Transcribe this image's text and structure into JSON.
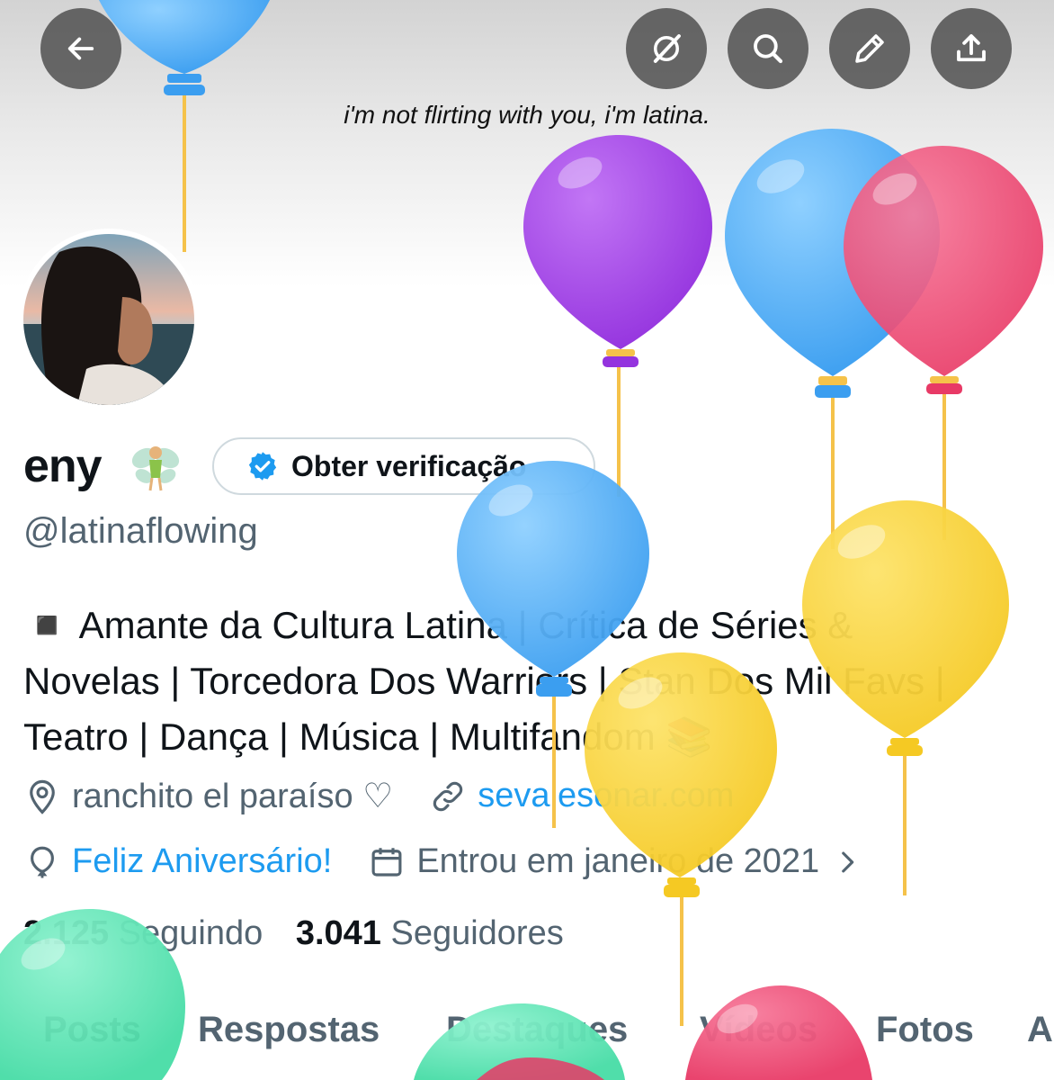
{
  "banner": {
    "caption": "i'm not flirting with you, i'm latina."
  },
  "toolbar": {
    "back_icon": "arrow-left-icon",
    "grok_icon": "grok-icon",
    "search_icon": "search-icon",
    "edit_icon": "pencil-icon",
    "share_icon": "share-icon"
  },
  "profile": {
    "display_name": "eny",
    "emoji": "fairy",
    "verify_button_label": "Obter verificação",
    "handle": "@latinaflowing",
    "bio_lines": [
      "◾ Amante da Cultura Latina | Crítica de Séries &",
      "Novelas | Torcedora Dos Warriors | Stan Dos Mil Favs |",
      "Teatro | Dança | Música | Multifandom 📚"
    ],
    "location": "ranchito el paraíso ♡",
    "website": "sevalesonar.com",
    "birthday": "Feliz Aniversário!",
    "joined": "Entrou em janeiro de 2021",
    "following_count": "2.125",
    "following_label": "Seguindo",
    "followers_count": "3.041",
    "followers_label": "Seguidores"
  },
  "tabs": [
    "Posts",
    "Respostas",
    "Destaques",
    "Vídeos",
    "Fotos",
    "A"
  ],
  "colors": {
    "accent": "#1d9bf0",
    "text_primary": "#0f1419",
    "text_secondary": "#536471",
    "balloon_blue": "#4aaaf0",
    "balloon_purple": "#a642e6",
    "balloon_red": "#ee4870",
    "balloon_yellow": "#f7d234",
    "balloon_green": "#5fe5b8"
  }
}
